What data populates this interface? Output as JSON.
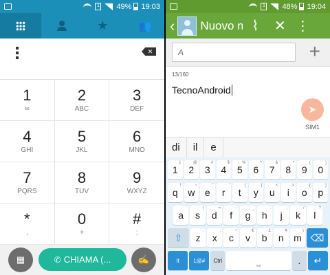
{
  "left": {
    "status": {
      "battery": "49%",
      "time": "19:03"
    },
    "tabs": [
      {
        "name": "tab-dialpad",
        "icon": "dialpad-grid-icon"
      },
      {
        "name": "tab-contacts",
        "icon": "person-icon"
      },
      {
        "name": "tab-favorites",
        "icon": "star-icon"
      },
      {
        "name": "tab-groups",
        "icon": "group-icon"
      }
    ],
    "keys": [
      {
        "d": "1",
        "l": "∞"
      },
      {
        "d": "2",
        "l": "ABC"
      },
      {
        "d": "3",
        "l": "DEF"
      },
      {
        "d": "4",
        "l": "GHI"
      },
      {
        "d": "5",
        "l": "JKL"
      },
      {
        "d": "6",
        "l": "MNO"
      },
      {
        "d": "7",
        "l": "PQRS"
      },
      {
        "d": "8",
        "l": "TUV"
      },
      {
        "d": "9",
        "l": "WXYZ"
      },
      {
        "d": "*",
        "l": ","
      },
      {
        "d": "0",
        "l": "+"
      },
      {
        "d": "#",
        "l": ";"
      }
    ],
    "call_label": "CHIAMA (..."
  },
  "right": {
    "status": {
      "battery": "48%",
      "time": "19:04"
    },
    "title": "Nuovo messaggio",
    "to_placeholder": "A",
    "counter": "13/160",
    "message": "TecnoAndroid",
    "sim_label": "SIM1",
    "suggestions": [
      "di",
      "il",
      "e"
    ],
    "keyboard": {
      "row1": [
        {
          "k": "1",
          "s": "1"
        },
        {
          "k": "2",
          "s": "@"
        },
        {
          "k": "3",
          "s": "#"
        },
        {
          "k": "4",
          "s": "$"
        },
        {
          "k": "5",
          "s": "%"
        },
        {
          "k": "6",
          "s": "^"
        },
        {
          "k": "7",
          "s": "&"
        },
        {
          "k": "8",
          "s": "*"
        },
        {
          "k": "9",
          "s": "("
        },
        {
          "k": "0",
          "s": ")"
        }
      ],
      "row2": [
        {
          "k": "q",
          "s": "!"
        },
        {
          "k": "w",
          "s": "~"
        },
        {
          "k": "e",
          "s": "\""
        },
        {
          "k": "r",
          "s": "'"
        },
        {
          "k": "t",
          "s": "["
        },
        {
          "k": "y",
          "s": "]"
        },
        {
          "k": "u",
          "s": "<"
        },
        {
          "k": "i",
          "s": ">"
        },
        {
          "k": "o",
          "s": "{"
        },
        {
          "k": "p",
          "s": "}"
        }
      ],
      "row3": [
        {
          "k": "a",
          "s": "`"
        },
        {
          "k": "s",
          "s": "|"
        },
        {
          "k": "d",
          "s": "="
        },
        {
          "k": "f",
          "s": "-"
        },
        {
          "k": "g",
          "s": "_"
        },
        {
          "k": "h",
          "s": ":"
        },
        {
          "k": "j",
          "s": ";"
        },
        {
          "k": "k",
          "s": "/"
        },
        {
          "k": "l",
          "s": "?"
        }
      ],
      "row4": [
        {
          "k": "z",
          "s": "."
        },
        {
          "k": "x",
          "s": ","
        },
        {
          "k": "c",
          "s": "+"
        },
        {
          "k": "v",
          "s": "€"
        },
        {
          "k": "b",
          "s": "£"
        },
        {
          "k": "n",
          "s": "¥"
        },
        {
          "k": "m",
          "s": "\\"
        }
      ],
      "lang_label": "It",
      "symbols_label": "1@#",
      "ctrl_label": "Ctrl",
      "period_label": "."
    }
  }
}
